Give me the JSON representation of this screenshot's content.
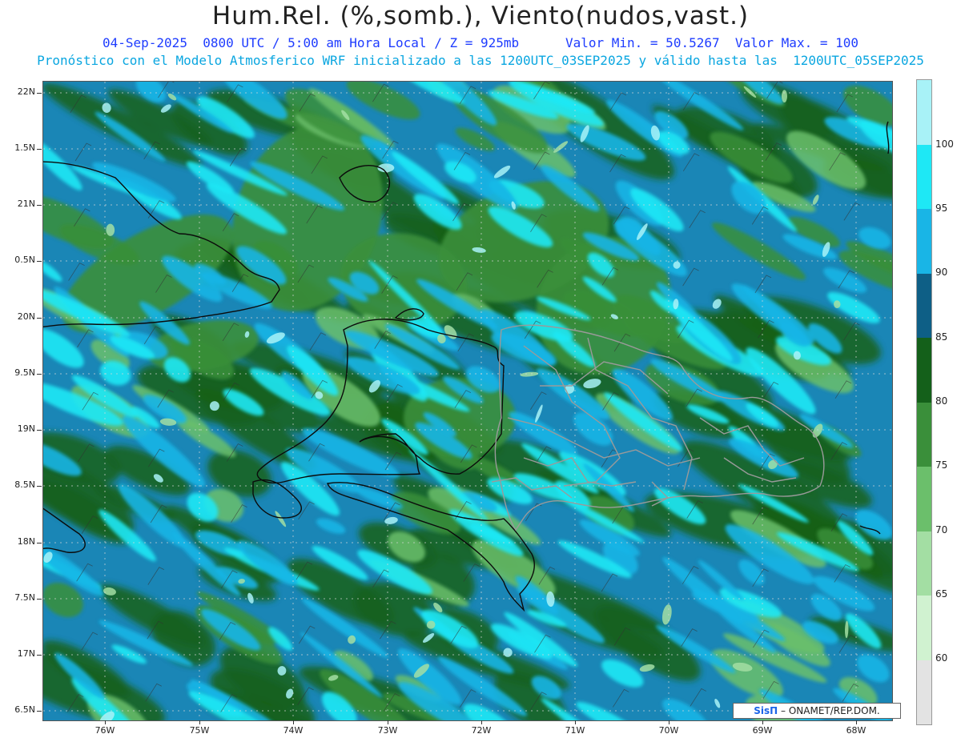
{
  "header": {
    "title": "Hum.Rel. (%,somb.), Viento(nudos,vast.)",
    "line1": "04-Sep-2025  0800 UTC / 5:00 am Hora Local / Z = 925mb      Valor Min. = 50.5267  Valor Max. = 100",
    "line2": "Pronóstico con el Modelo Atmosferico WRF inicializado a las 1200UTC_03SEP2025 y válido hasta las  1200UTC_05SEP2025"
  },
  "axes": {
    "lat_labels": [
      "22N",
      "1.5N",
      "21N",
      "0.5N",
      "20N",
      "9.5N",
      "19N",
      "8.5N",
      "18N",
      "7.5N",
      "17N",
      "6.5N"
    ],
    "lon_labels": [
      "76W",
      "75W",
      "74W",
      "73W",
      "72W",
      "71W",
      "70W",
      "69W",
      "68W"
    ]
  },
  "colorbar": {
    "labels": [
      "100",
      "95",
      "90",
      "85",
      "80",
      "75",
      "70",
      "65",
      "60"
    ],
    "colors": [
      "#e3e3e3",
      "#d0f2d0",
      "#a3dea3",
      "#6bbf6b",
      "#3a8f3a",
      "#14601a",
      "#0e5f86",
      "#19b5e6",
      "#1ee8f5",
      "#a8f2f7"
    ]
  },
  "credit": {
    "brand": "SisΠ",
    "text": "– ONAMET/REP.DOM."
  },
  "icons": {
    "brand_logo": "sispi-logo-icon"
  }
}
